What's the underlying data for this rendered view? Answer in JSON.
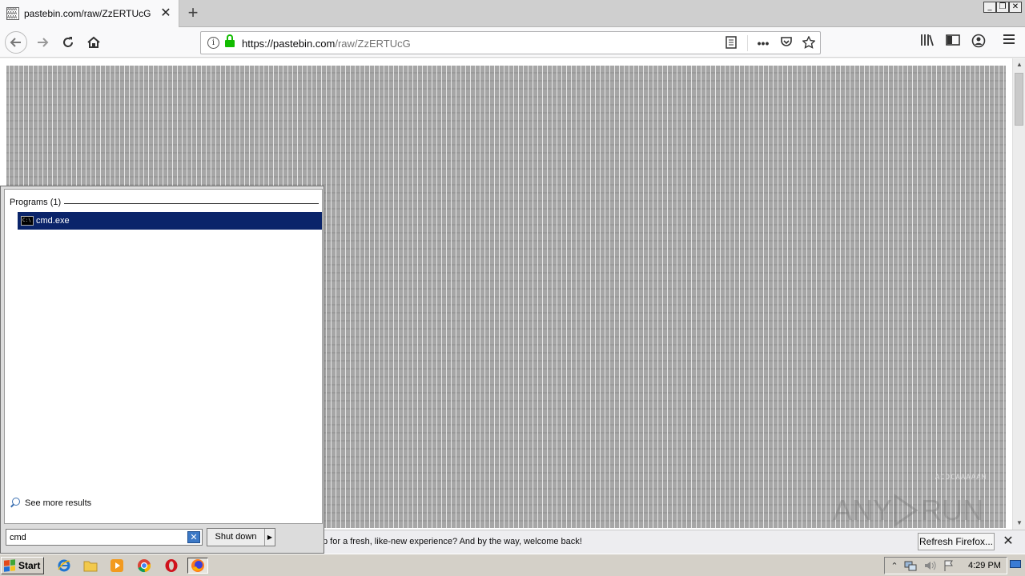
{
  "browser": {
    "tab_title": "pastebin.com/raw/ZzERTUcG",
    "url_host": "https://pastebin.com",
    "url_path": "/raw/ZzERTUcG",
    "window_controls": [
      "_",
      "❐",
      "✕"
    ]
  },
  "page": {
    "content_char": "A",
    "tail_text": "ACDCAAAAAM"
  },
  "notification": {
    "message": "p for a fresh, like-new experience? And by the way, welcome back!",
    "button": "Refresh Firefox..."
  },
  "start_menu": {
    "programs_header": "Programs (1)",
    "result_item": "cmd.exe",
    "see_more": "See more results",
    "search_value": "cmd",
    "shutdown_label": "Shut down"
  },
  "taskbar": {
    "start_label": "Start",
    "clock": "4:29 PM",
    "pinned": [
      "internet-explorer-icon",
      "explorer-folder-icon",
      "media-player-icon",
      "chrome-icon",
      "opera-icon",
      "firefox-icon"
    ]
  },
  "watermark": {
    "text": "ANY RUN"
  },
  "colors": {
    "selection": "#0a246a",
    "lock_green": "#12bc00",
    "taskbar": "#d4d0c8"
  }
}
